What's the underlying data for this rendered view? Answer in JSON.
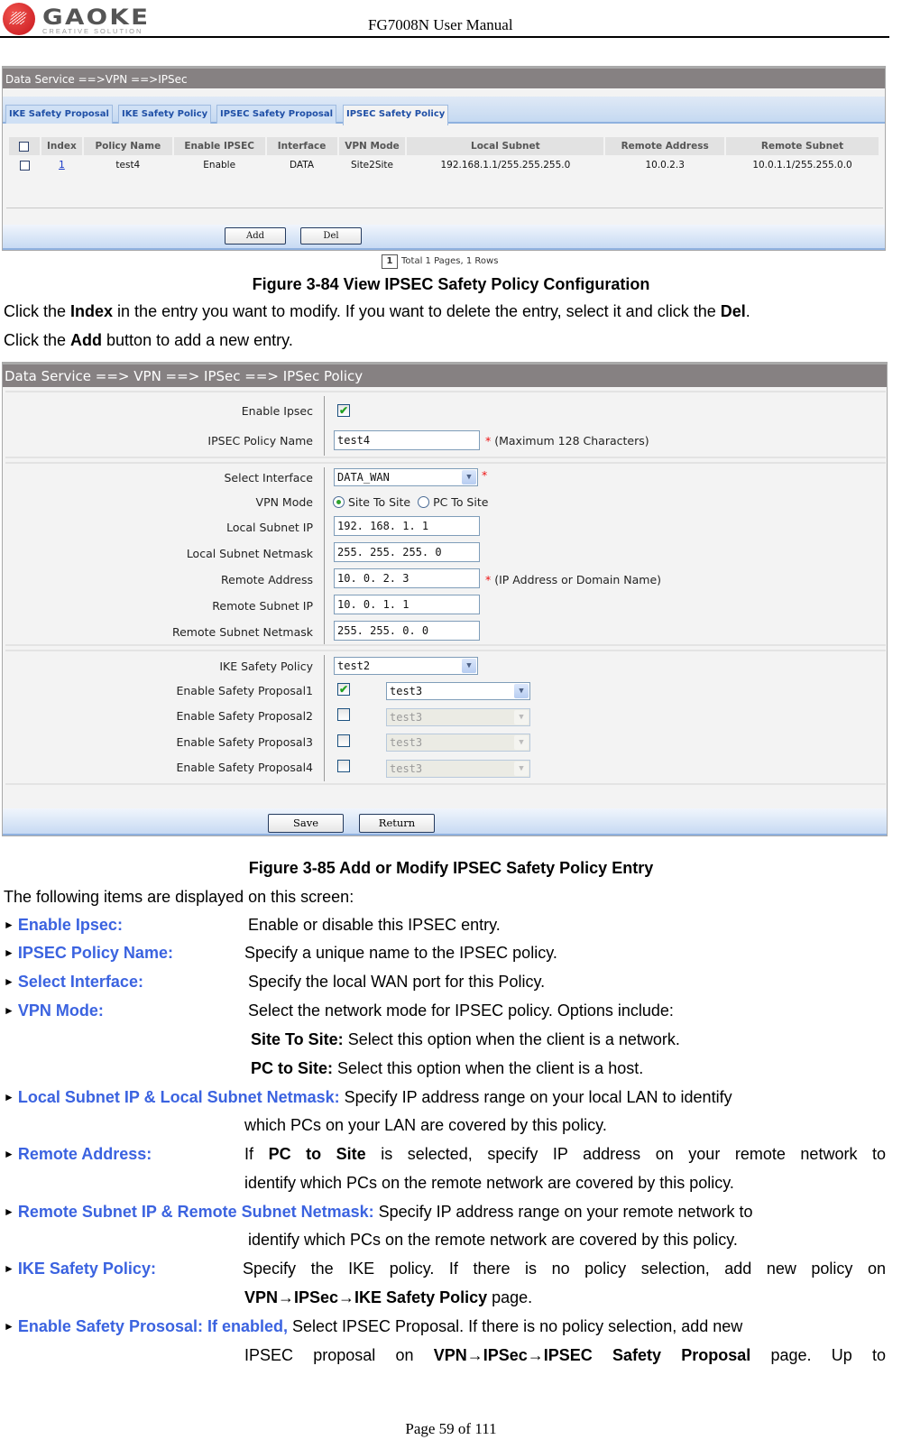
{
  "header": {
    "logo_word": "GAOKE",
    "logo_tagline": "CREATIVE SOLUTION",
    "doc_title": "FG7008N User Manual"
  },
  "fig84": {
    "breadcrumb": "Data Service ==>VPN ==>IPSec",
    "tabs": [
      {
        "label": "IKE Safety Proposal",
        "active": false
      },
      {
        "label": "IKE Safety Policy",
        "active": false
      },
      {
        "label": "IPSEC Safety Proposal",
        "active": false
      },
      {
        "label": "IPSEC Safety Policy",
        "active": true
      }
    ],
    "table": {
      "columns": [
        "",
        "Index",
        "Policy Name",
        "Enable IPSEC",
        "Interface",
        "VPN Mode",
        "Local Subnet",
        "Remote Address",
        "Remote Subnet"
      ],
      "rows": [
        {
          "index": "1",
          "policy_name": "test4",
          "enable_ipsec": "Enable",
          "interface": "DATA",
          "vpn_mode": "Site2Site",
          "local_subnet": "192.168.1.1/255.255.255.0",
          "remote_address": "10.0.2.3",
          "remote_subnet": "10.0.1.1/255.255.0.0"
        }
      ]
    },
    "pager": {
      "page": "1",
      "summary": "Total 1 Pages, 1 Rows"
    },
    "buttons": {
      "add": "Add",
      "del": "Del"
    },
    "caption": "Figure 3-84   View IPSEC Safety Policy Configuration"
  },
  "para1": {
    "line1": [
      {
        "t": "Click the ",
        "b": false
      },
      {
        "t": "Index",
        "b": true
      },
      {
        "t": " in the entry you want to modify. If you want to delete the entry, select it and click the ",
        "b": false
      },
      {
        "t": "Del",
        "b": true
      },
      {
        "t": ".",
        "b": false
      }
    ],
    "line2": [
      {
        "t": "Click the ",
        "b": false
      },
      {
        "t": "Add",
        "b": true
      },
      {
        "t": " button to add a new entry.",
        "b": false
      }
    ]
  },
  "fig85": {
    "breadcrumb": "Data Service ==> VPN ==> IPSec ==> IPSec Policy",
    "fields": {
      "enable_ipsec": {
        "label": "Enable Ipsec",
        "checked": true
      },
      "policy_name": {
        "label": "IPSEC Policy Name",
        "value": "test4",
        "hint": "(Maximum 128 Characters)"
      },
      "select_interface": {
        "label": "Select Interface",
        "value": "DATA_WAN"
      },
      "vpn_mode": {
        "label": "VPN Mode",
        "options": [
          "Site To Site",
          "PC To Site"
        ],
        "selected": "Site To Site"
      },
      "local_subnet_ip": {
        "label": "Local Subnet IP",
        "value": "192. 168. 1. 1"
      },
      "local_subnet_netmask": {
        "label": "Local Subnet Netmask",
        "value": "255. 255. 255. 0"
      },
      "remote_address": {
        "label": "Remote Address",
        "value": "10. 0. 2. 3",
        "hint": "(IP Address or Domain Name)"
      },
      "remote_subnet_ip": {
        "label": "Remote Subnet IP",
        "value": "10. 0. 1. 1"
      },
      "remote_subnet_netmask": {
        "label": "Remote Subnet Netmask",
        "value": "255. 255. 0. 0"
      },
      "ike_policy": {
        "label": "IKE Safety Policy",
        "value": "test2"
      },
      "proposals": [
        {
          "label": "Enable Safety Proposal1",
          "checked": true,
          "value": "test3"
        },
        {
          "label": "Enable Safety Proposal2",
          "checked": false,
          "value": "test3"
        },
        {
          "label": "Enable Safety Proposal3",
          "checked": false,
          "value": "test3"
        },
        {
          "label": "Enable Safety Proposal4",
          "checked": false,
          "value": "test3"
        }
      ]
    },
    "required_mark": "*",
    "buttons": {
      "save": "Save",
      "return": "Return"
    },
    "caption": "Figure 3-85   Add or Modify IPSEC Safety Policy Entry"
  },
  "desc": {
    "intro": "The following items are displayed on this screen:",
    "bullet": "►",
    "items": [
      {
        "key": "Enable Ipsec:",
        "text": "Enable or disable this IPSEC entry."
      },
      {
        "key": "IPSEC Policy Name:",
        "text": "Specify a unique name to the IPSEC policy."
      },
      {
        "key": "Select Interface:",
        "text": "Specify the local WAN port for this Policy."
      },
      {
        "key": "VPN Mode:",
        "text": "Select the network mode for IPSEC policy. Options include:"
      },
      {
        "key": "Local Subnet IP & Local Subnet Netmask:",
        "text": "Specify IP address range on your local LAN to identify"
      },
      {
        "key": "Remote  Address:",
        "text": ""
      },
      {
        "key": "Remote Subnet IP & Remote Subnet Netmask:",
        "text": "Specify IP address range on your remote network to"
      },
      {
        "key": "IKE  Safety  Policy:",
        "text": "Specify  the  IKE  policy.  If  there  is  no  policy  selection,  add  new  policy  on"
      },
      {
        "key": "Enable Safety Prososal:",
        "text": ""
      }
    ],
    "site_to_site": {
      "b": "Site To Site:",
      "t": " Select this option when the client is a network."
    },
    "pc_to_site": {
      "b": "PC to Site:",
      "t": " Select this option when the client is a host."
    },
    "local_cont": "which PCs on your LAN are covered by this policy.",
    "remote_addr_line1": {
      "a": "If ",
      "b": "PC  to  Site",
      "c": " is  selected,  specify  IP  address  on  your  remote  network  to"
    },
    "remote_addr_cont": "identify which PCs on the remote network are covered by this policy.",
    "remote_subnet_cont": "identify which PCs on the remote network are covered by this policy.",
    "ike_cont": {
      "b": "VPN→IPSec→IKE Safety Policy",
      "t": " page."
    },
    "proposal_line1": {
      "k": "If enabled,",
      "t": " Select IPSEC Proposal. If there is no policy selection, add new"
    },
    "proposal_line2": {
      "a": "IPSEC  proposal  on  ",
      "b": "VPN→IPSec→IPSEC  Safety  Proposal",
      "c": "  page.  Up  to"
    }
  },
  "footer": "Page 59 of 111"
}
